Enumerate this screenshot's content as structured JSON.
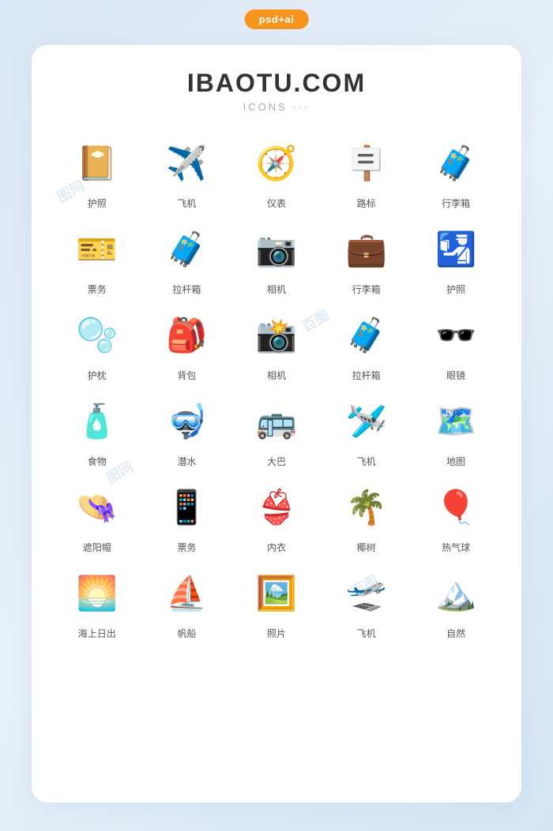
{
  "badge": "psd+ai",
  "header": {
    "title": "IBAOTU.COM",
    "subtitle": "ICONS ···"
  },
  "icons": [
    {
      "id": "passport1",
      "label": "护照",
      "emoji": "📔",
      "color": "#8B5E3C"
    },
    {
      "id": "plane1",
      "label": "飞机",
      "emoji": "✈️",
      "color": "#6aabf7"
    },
    {
      "id": "compass",
      "label": "仪表",
      "emoji": "🧭",
      "color": "#4a4a6a"
    },
    {
      "id": "signpost",
      "label": "路标",
      "emoji": "🪧",
      "color": "#e8a020"
    },
    {
      "id": "suitcase1",
      "label": "行李箱",
      "emoji": "🧳",
      "color": "#8B6914"
    },
    {
      "id": "ticket",
      "label": "票务",
      "emoji": "🎫",
      "color": "#6aabf7"
    },
    {
      "id": "luggage",
      "label": "拉杆箱",
      "emoji": "🧳",
      "color": "#f5a623"
    },
    {
      "id": "camera1",
      "label": "相机",
      "emoji": "📷",
      "color": "#333"
    },
    {
      "id": "suitcase2",
      "label": "行李箱",
      "emoji": "💼",
      "color": "#2a5298"
    },
    {
      "id": "passport2",
      "label": "护照",
      "emoji": "🛂",
      "color": "#f5a623"
    },
    {
      "id": "pillow",
      "label": "护枕",
      "emoji": "🫧",
      "color": "#5bc8f5"
    },
    {
      "id": "backpack",
      "label": "背包",
      "emoji": "🎒",
      "color": "#e8641a"
    },
    {
      "id": "camera2",
      "label": "相机",
      "emoji": "📸",
      "color": "#5bc8f5"
    },
    {
      "id": "trolley",
      "label": "拉杆箱",
      "emoji": "🧳",
      "color": "#5bc8f5"
    },
    {
      "id": "glasses",
      "label": "眼镜",
      "emoji": "🕶️",
      "color": "#1a2a5a"
    },
    {
      "id": "food",
      "label": "食物",
      "emoji": "🧴",
      "color": "#f5a623"
    },
    {
      "id": "diving",
      "label": "潜水",
      "emoji": "🤿",
      "color": "#e8303a"
    },
    {
      "id": "bus",
      "label": "大巴",
      "emoji": "🚌",
      "color": "#5bc8f5"
    },
    {
      "id": "plane2",
      "label": "飞机",
      "emoji": "🛩️",
      "color": "#3a7bd5"
    },
    {
      "id": "map",
      "label": "地图",
      "emoji": "🗺️",
      "color": "#5bc8f5"
    },
    {
      "id": "hat",
      "label": "遮阳帽",
      "emoji": "👒",
      "color": "#e8641a"
    },
    {
      "id": "phone",
      "label": "票务",
      "emoji": "📱",
      "color": "#2a5298"
    },
    {
      "id": "bikini",
      "label": "内衣",
      "emoji": "👙",
      "color": "#f5a623"
    },
    {
      "id": "palmtree",
      "label": "椰树",
      "emoji": "🌴",
      "color": "#2d8a2d"
    },
    {
      "id": "balloon",
      "label": "热气球",
      "emoji": "🎈",
      "color": "#e8303a"
    },
    {
      "id": "sunrise",
      "label": "海上日出",
      "emoji": "🌅",
      "color": "#e8641a"
    },
    {
      "id": "sailboat",
      "label": "帆船",
      "emoji": "⛵",
      "color": "#f5f5f5"
    },
    {
      "id": "photo",
      "label": "照片",
      "emoji": "🖼️",
      "color": "#5bc8f5"
    },
    {
      "id": "plane3",
      "label": "飞机",
      "emoji": "🛫",
      "color": "#3a7bd5"
    },
    {
      "id": "nature",
      "label": "自然",
      "emoji": "🏔️",
      "color": "#8B6914"
    }
  ]
}
